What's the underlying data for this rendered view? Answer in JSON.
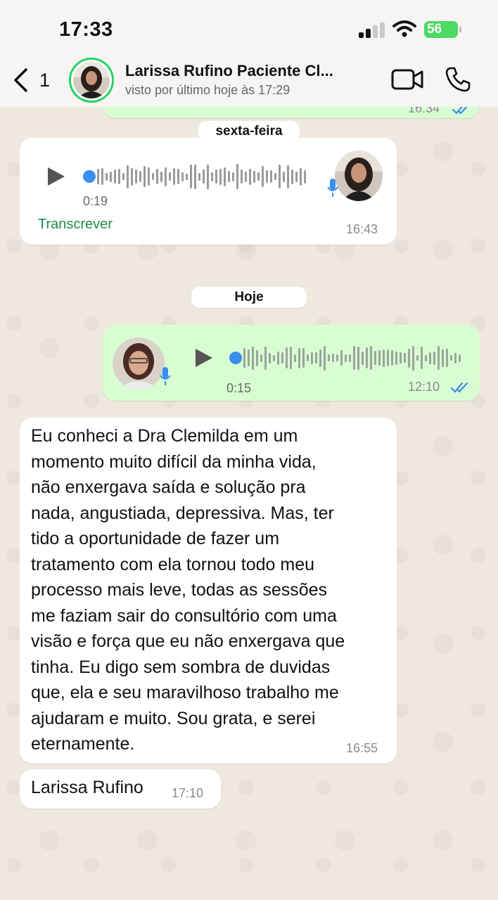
{
  "status_bar": {
    "time": "17:33",
    "battery": "56"
  },
  "header": {
    "back_count": "1",
    "contact_name": "Larissa Rufino Paciente Cl...",
    "last_seen": "visto por último hoje às 17:29"
  },
  "chat": {
    "top_partial_time": "16:34",
    "date_chip_1": "sexta-feira",
    "voice_in": {
      "duration": "0:19",
      "transcribe": "Transcrever",
      "time": "16:43"
    },
    "date_chip_2": "Hoje",
    "voice_out": {
      "duration": "0:15",
      "time": "12:10"
    },
    "text_msg": {
      "text": "Eu conheci a Dra Clemilda em um\nmomento muito difícil da minha vida,\nnão enxergava saída e solução pra\nnada, angustiada, depressiva. Mas, ter\ntido a oportunidade de fazer um\ntratamento com ela tornou todo meu\nprocesso mais leve, todas as sessões\nme faziam sair do consultório com uma\nvisão e força que eu não enxergava que\ntinha. Eu digo sem sombra de duvidas\nque, ela e seu maravilhoso trabalho me\najudaram e muito. Sou grata, e serei\neternamente.",
      "time": "16:55"
    },
    "signature_msg": {
      "text": "Larissa Rufino",
      "time": "17:10"
    }
  },
  "colors": {
    "outgoing_bubble": "#d9fdd3",
    "incoming_bubble": "#ffffff",
    "read_ticks": "#3b8ef0",
    "accent_green": "#25d366"
  },
  "icons": [
    "back-chevron-icon",
    "video-call-icon",
    "phone-icon",
    "play-icon",
    "mic-icon",
    "double-check-icon",
    "signal-icon",
    "wifi-icon",
    "battery-icon"
  ]
}
